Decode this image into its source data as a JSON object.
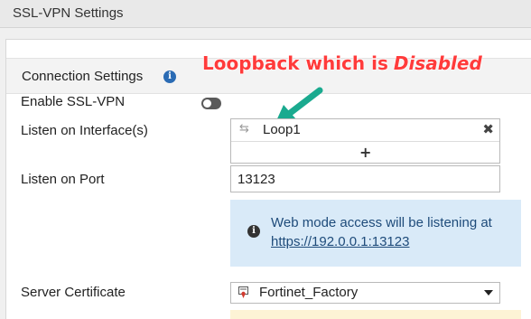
{
  "page": {
    "title": "SSL-VPN Settings"
  },
  "section": {
    "label": "Connection Settings",
    "info_icon_glyph": "i"
  },
  "annotation": {
    "text_prefix": "Loopback which is",
    "text_emphasis": "Disabled",
    "color": "#ff3b3b",
    "arrow_color": "#1aaa8f"
  },
  "fields": {
    "enable_label": "Enable SSL-VPN",
    "enable_state": "off",
    "interfaces_label": "Listen on Interface(s)",
    "interfaces": [
      {
        "name": "Loop1",
        "icon": "link-icon"
      }
    ],
    "add_glyph": "+",
    "remove_glyph": "✖",
    "port_label": "Listen on Port",
    "port_value": "13123",
    "cert_label": "Server Certificate",
    "cert_value": "Fortinet_Factory"
  },
  "notice": {
    "icon_glyph": "i",
    "text": "Web mode access will be listening at",
    "link": "https://192.0.0.1:13123",
    "background": "#d9eaf8"
  },
  "icons": {
    "link_glyph": "⇆"
  }
}
